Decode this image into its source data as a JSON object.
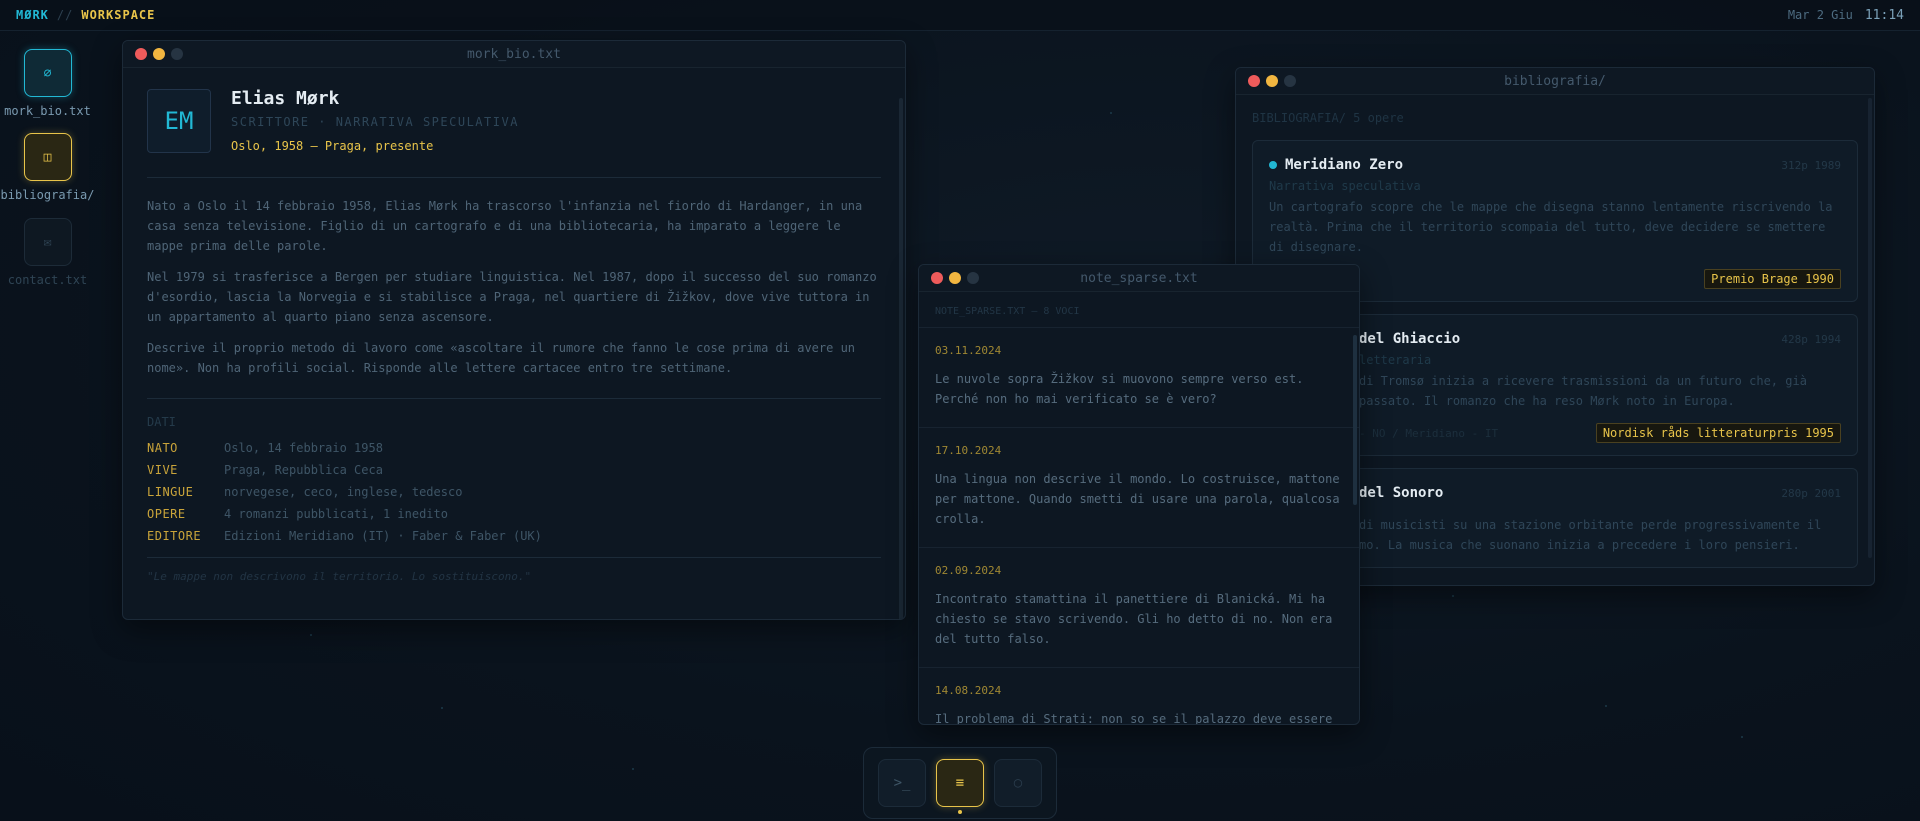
{
  "topbar": {
    "brand_a": "MØRK",
    "sep": "//",
    "brand_b": "WORKSPACE",
    "date": "Mar 2 Giu",
    "time": "11:14"
  },
  "desktop": [
    {
      "icon": "⌀",
      "label": "mork_bio.txt",
      "icon_name": "no-entry-icon"
    },
    {
      "icon": "◫",
      "label": "bibliografia/",
      "icon_name": "folder-icon"
    },
    {
      "icon": "✉",
      "label": "contact.txt",
      "icon_name": "envelope-icon"
    }
  ],
  "bio": {
    "window_title": "mork_bio.txt",
    "initials": "EM",
    "name": "Elias Mørk",
    "role": "SCRITTORE · NARRATIVA SPECULATIVA",
    "life": "Oslo, 1958 — Praga, presente",
    "paragraphs": [
      "Nato a Oslo il 14 febbraio 1958, Elias Mørk ha trascorso l'infanzia nel fiordo di Hardanger, in una casa senza televisione. Figlio di un cartografo e di una bibliotecaria, ha imparato a leggere le mappe prima delle parole.",
      "Nel 1979 si trasferisce a Bergen per studiare linguistica. Nel 1987, dopo il successo del suo romanzo d'esordio, lascia la Norvegia e si stabilisce a Praga, nel quartiere di Žižkov, dove vive tuttora in un appartamento al quarto piano senza ascensore.",
      "Descrive il proprio metodo di lavoro come «ascoltare il rumore che fanno le cose prima di avere un nome». Non ha profili social. Risponde alle lettere cartacee entro tre settimane."
    ],
    "data_label": "DATI",
    "facts": [
      {
        "key": "NATO",
        "value": "Oslo, 14 febbraio 1958"
      },
      {
        "key": "VIVE",
        "value": "Praga, Repubblica Ceca"
      },
      {
        "key": "LINGUE",
        "value": "norvegese, ceco, inglese, tedesco"
      },
      {
        "key": "OPERE",
        "value": "4 romanzi pubblicati, 1 inedito"
      },
      {
        "key": "EDITORE",
        "value": "Edizioni Meridiano (IT) · Faber & Faber (UK)"
      }
    ],
    "quote": "\"Le mappe non descrivono il territorio. Lo sostituiscono.\""
  },
  "biblio": {
    "window_title": "bibliografia/",
    "header": "BIBLIOGRAFIA/ 5 opere",
    "cards": [
      {
        "title": "Meridiano Zero",
        "meta": "312p 1989",
        "genre": "Narrativa speculativa",
        "desc": "Un cartografo scopre che le mappe che disegna stanno lentamente riscrivendo la realtà. Prima che il territorio scompaia del tutto, deve decidere se smettere di disegnare.",
        "pub": "",
        "award": "Premio Brage 1990"
      },
      {
        "title": "del Ghiaccio",
        "meta": "428p 1994",
        "genre": "letteraria",
        "desc": "di Tromsø inizia a ricevere trasmissioni da un futuro che, già passato. Il romanzo che ha reso Mørk noto in Europa.",
        "pub": "- NO / Meridiano - IT",
        "award": "Nordisk råds litteraturpris 1995"
      },
      {
        "title": "del Sonoro",
        "meta": "280p 2001",
        "genre": "",
        "desc": "di musicisti su una stazione orbitante perde progressivamente il mo. La musica che suonano inizia a precedere i loro pensieri.",
        "pub": "",
        "award": ""
      }
    ]
  },
  "notes": {
    "window_title": "note_sparse.txt",
    "header": "NOTE_SPARSE.TXT — 8 VOCI",
    "items": [
      {
        "date": "03.11.2024",
        "text": "Le nuvole sopra Žižkov si muovono sempre verso est. Perché non ho mai verificato se è vero?"
      },
      {
        "date": "17.10.2024",
        "text": "Una lingua non descrive il mondo. Lo costruisce, mattone per mattone. Quando smetti di usare una parola, qualcosa crolla."
      },
      {
        "date": "02.09.2024",
        "text": "Incontrato stamattina il panettiere di Blanická. Mi ha chiesto se stavo scrivendo. Gli ho detto di no. Non era del tutto falso."
      },
      {
        "date": "14.08.2024",
        "text": "Il problema di Strati: non so se il palazzo deve essere"
      }
    ]
  },
  "dock": [
    {
      "icon": ">_",
      "icon_name": "terminal-icon",
      "active": false
    },
    {
      "icon": "≡",
      "icon_name": "menu-icon",
      "active": true
    },
    {
      "icon": "○",
      "icon_name": "circle-icon",
      "active": false
    }
  ],
  "colors": {
    "accent_cyan": "#22b8d4",
    "accent_yellow": "#e8c44a",
    "close": "#ee5b5b",
    "minimize": "#f2b640"
  }
}
